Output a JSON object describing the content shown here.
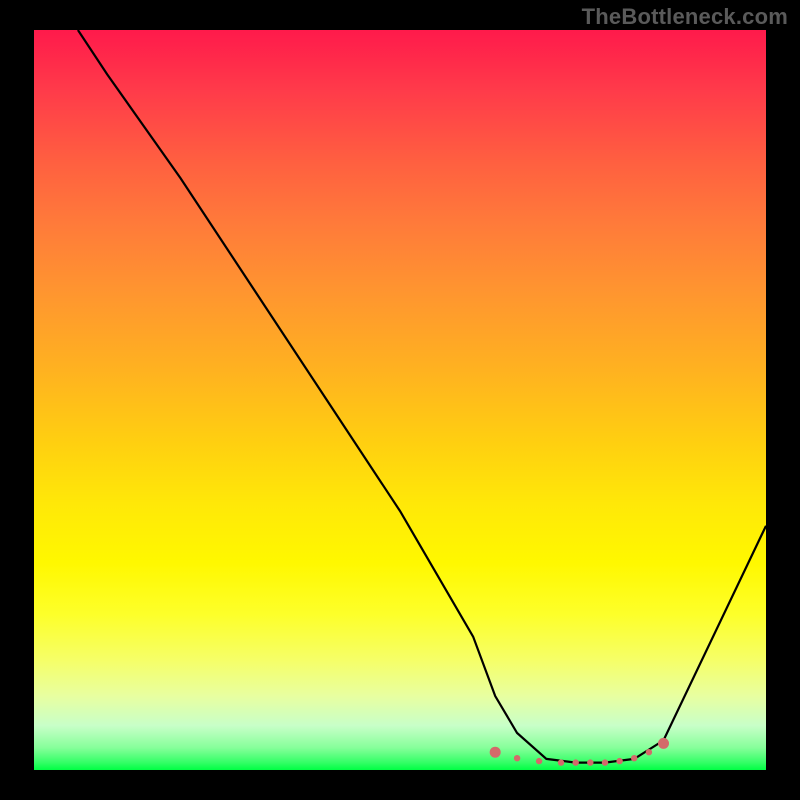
{
  "watermark": "TheBottleneck.com",
  "chart_data": {
    "type": "line",
    "title": "",
    "xlabel": "",
    "ylabel": "",
    "xlim": [
      0,
      100
    ],
    "ylim": [
      0,
      100
    ],
    "series": [
      {
        "name": "curve",
        "x": [
          6,
          10,
          20,
          30,
          40,
          50,
          60,
          63,
          66,
          70,
          74,
          78,
          82,
          86,
          100
        ],
        "y": [
          100,
          94,
          80,
          65,
          50,
          35,
          18,
          10,
          5,
          1.5,
          1,
          1,
          1.5,
          4,
          33
        ]
      }
    ],
    "markers": {
      "name": "highlight-region",
      "color": "#d46a6a",
      "x": [
        63,
        66,
        69,
        72,
        74,
        76,
        78,
        80,
        82,
        84,
        86
      ],
      "y": [
        2.4,
        1.6,
        1.2,
        1.0,
        1.0,
        1.0,
        1.0,
        1.2,
        1.6,
        2.4,
        3.6
      ]
    },
    "background_gradient": {
      "top": "#ff1a4b",
      "mid": "#ffe000",
      "bottom": "#00ff44"
    }
  }
}
